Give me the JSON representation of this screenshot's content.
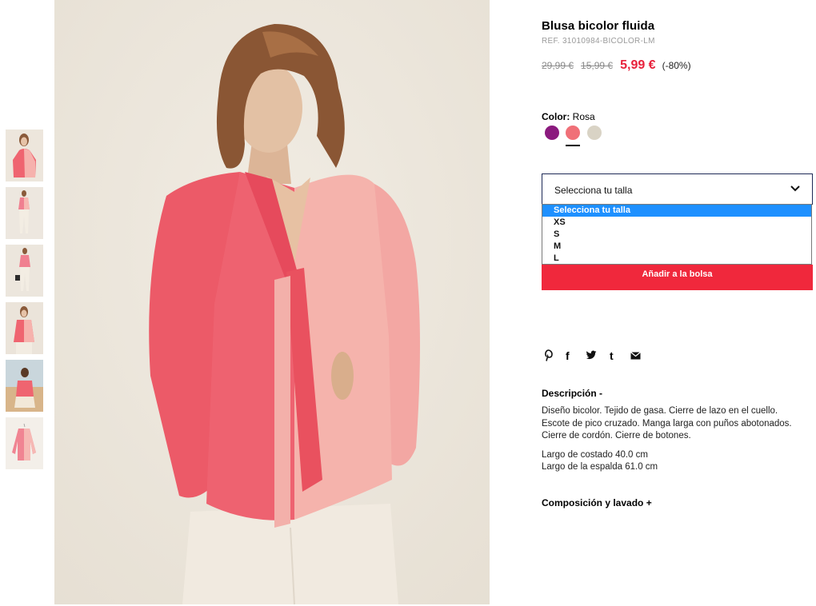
{
  "product": {
    "title": "Blusa bicolor fluida",
    "ref": "REF. 31010984-BICOLOR-LM",
    "prices": {
      "original": "29,99 €",
      "previous": "15,99 €",
      "current": "5,99 €",
      "discount": "(-80%)"
    }
  },
  "color": {
    "label": "Color:",
    "selected": "Rosa",
    "swatches": [
      {
        "name": "purple",
        "hex": "#8b1a7e"
      },
      {
        "name": "rosa",
        "hex": "#f07078",
        "selected": true
      },
      {
        "name": "beige",
        "hex": "#d9d3c5"
      }
    ]
  },
  "size": {
    "select_label": "Selecciona tu talla",
    "options": [
      "Selecciona tu talla",
      "XS",
      "S",
      "M",
      "L"
    ],
    "highlighted_option": "Selecciona tu talla"
  },
  "cart": {
    "add_label": "Añadir a la bolsa"
  },
  "share": {
    "icons": [
      "pinterest-icon",
      "facebook-icon",
      "twitter-icon",
      "tumblr-icon",
      "email-icon"
    ],
    "facebook_glyph": "f",
    "tumblr_glyph": "t"
  },
  "description": {
    "heading": "Descripción -",
    "lines": [
      "Diseño bicolor. Tejido de gasa. Cierre de lazo en el cuello.",
      "Escote de pico cruzado. Manga larga con puños abotonados.",
      "Cierre de cordón. Cierre de botones."
    ],
    "measures": [
      "Largo de costado 40.0 cm",
      "Largo de la espalda 61.0 cm"
    ]
  },
  "composition": {
    "heading": "Composición y lavado +"
  },
  "colors": {
    "price_accent": "#e8223c",
    "button": "#f0283c",
    "dropdown_highlight": "#1e90ff",
    "select_border": "#1e2a57"
  },
  "thumbnails": [
    "thumbnail-front-closeup",
    "thumbnail-full-body",
    "thumbnail-full-body-bag",
    "thumbnail-front-waist",
    "thumbnail-lifestyle",
    "thumbnail-flat-product"
  ]
}
